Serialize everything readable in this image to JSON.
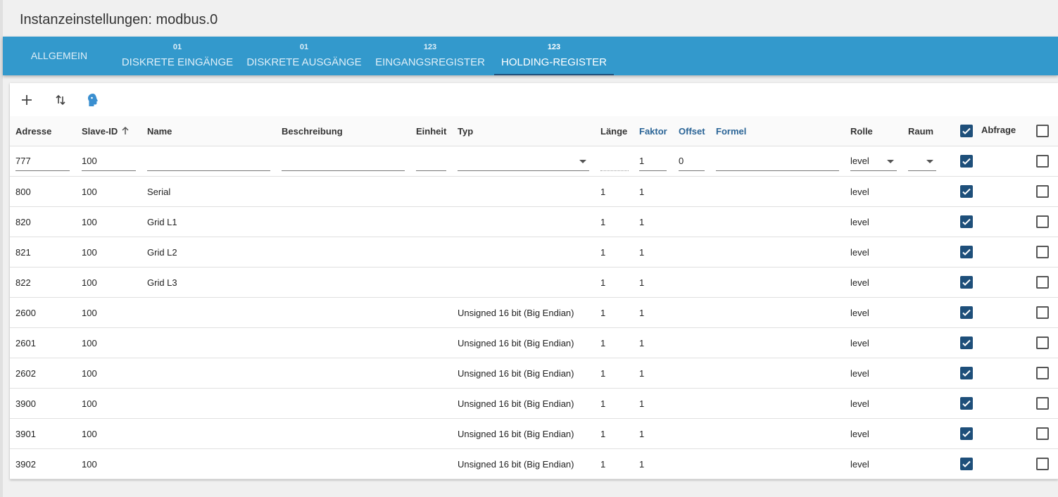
{
  "header": {
    "title": "Instanzeinstellungen: modbus.0"
  },
  "tabs": [
    {
      "badge": "",
      "label": "ALLGEMEIN"
    },
    {
      "badge": "01",
      "label": "DISKRETE EINGÄNGE"
    },
    {
      "badge": "01",
      "label": "DISKRETE AUSGÄNGE"
    },
    {
      "badge": "123",
      "label": "EINGANGSREGISTER"
    },
    {
      "badge": "123",
      "label": "HOLDING-REGISTER"
    }
  ],
  "toolbar": {
    "add_icon": "plus-icon",
    "sort_icon": "sort-arrows-icon",
    "import_icon": "head-icon"
  },
  "columns": {
    "adresse": "Adresse",
    "slave_id": "Slave-ID",
    "name": "Name",
    "beschreibung": "Beschreibung",
    "einheit": "Einheit",
    "typ": "Typ",
    "laenge": "Länge",
    "faktor": "Faktor",
    "offset": "Offset",
    "formel": "Formel",
    "rolle": "Rolle",
    "raum": "Raum",
    "abfrage": "Abfrage"
  },
  "new_row": {
    "adresse": "777",
    "slave_id": "100",
    "name": "",
    "beschreibung": "",
    "einheit": "",
    "typ": "",
    "laenge": "",
    "faktor": "1",
    "offset": "0",
    "formel": "",
    "rolle": "level",
    "raum": ""
  },
  "rows": [
    {
      "adresse": "800",
      "slave_id": "100",
      "name": "Serial",
      "typ": "",
      "laenge": "1",
      "faktor": "1",
      "rolle": "level"
    },
    {
      "adresse": "820",
      "slave_id": "100",
      "name": "Grid L1",
      "typ": "",
      "laenge": "1",
      "faktor": "1",
      "rolle": "level"
    },
    {
      "adresse": "821",
      "slave_id": "100",
      "name": "Grid L2",
      "typ": "",
      "laenge": "1",
      "faktor": "1",
      "rolle": "level"
    },
    {
      "adresse": "822",
      "slave_id": "100",
      "name": "Grid L3",
      "typ": "",
      "laenge": "1",
      "faktor": "1",
      "rolle": "level"
    },
    {
      "adresse": "2600",
      "slave_id": "100",
      "name": "",
      "typ": "Unsigned 16 bit (Big Endian)",
      "laenge": "1",
      "faktor": "1",
      "rolle": "level"
    },
    {
      "adresse": "2601",
      "slave_id": "100",
      "name": "",
      "typ": "Unsigned 16 bit (Big Endian)",
      "laenge": "1",
      "faktor": "1",
      "rolle": "level"
    },
    {
      "adresse": "2602",
      "slave_id": "100",
      "name": "",
      "typ": "Unsigned 16 bit (Big Endian)",
      "laenge": "1",
      "faktor": "1",
      "rolle": "level"
    },
    {
      "adresse": "3900",
      "slave_id": "100",
      "name": "",
      "typ": "Unsigned 16 bit (Big Endian)",
      "laenge": "1",
      "faktor": "1",
      "rolle": "level"
    },
    {
      "adresse": "3901",
      "slave_id": "100",
      "name": "",
      "typ": "Unsigned 16 bit (Big Endian)",
      "laenge": "1",
      "faktor": "1",
      "rolle": "level"
    },
    {
      "adresse": "3902",
      "slave_id": "100",
      "name": "",
      "typ": "Unsigned 16 bit (Big Endian)",
      "laenge": "1",
      "faktor": "1",
      "rolle": "level"
    }
  ],
  "colors": {
    "tabbar": "#3399cc",
    "checkbox_checked": "#1e4f7a",
    "header_link": "#2a6496"
  }
}
